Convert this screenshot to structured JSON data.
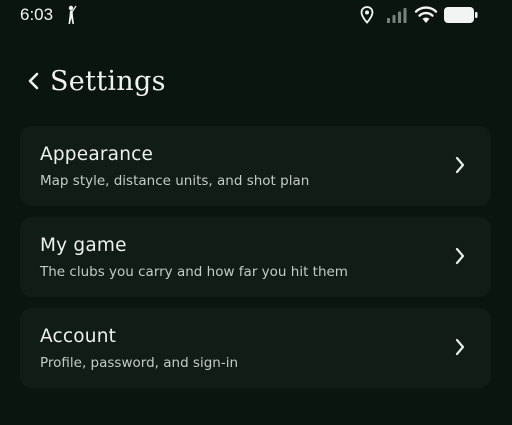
{
  "status": {
    "time": "6:03",
    "icons": [
      "golfer-icon",
      "location-icon",
      "signal-icon",
      "wifi-icon",
      "battery-icon"
    ]
  },
  "header": {
    "back_icon": "chevron-left-icon",
    "title": "Settings"
  },
  "menu": [
    {
      "title": "Appearance",
      "subtitle": "Map style, distance units, and shot plan"
    },
    {
      "title": "My game",
      "subtitle": "The clubs you carry and how far you hit them"
    },
    {
      "title": "Account",
      "subtitle": "Profile, password, and sign-in"
    }
  ],
  "colors": {
    "background": "#0b1510",
    "card": "#111c16",
    "text": "#eef1ef",
    "subtext": "#c3cbc6"
  }
}
